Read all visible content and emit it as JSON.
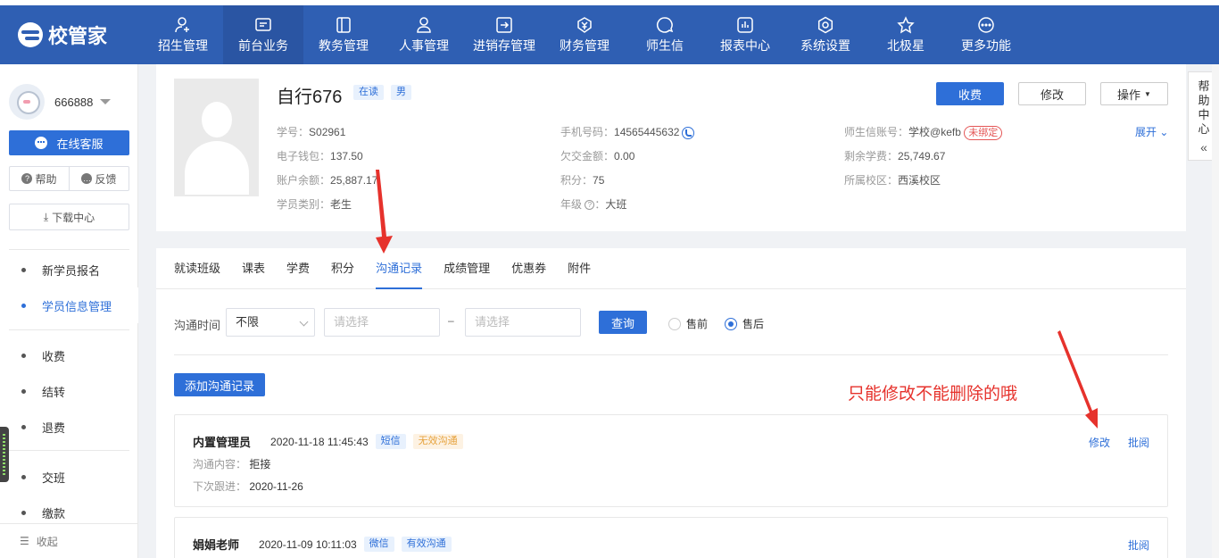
{
  "app": {
    "brand": "校管家"
  },
  "nav": {
    "items": [
      {
        "label": "招生管理",
        "icon": "person-add-icon"
      },
      {
        "label": "前台业务",
        "icon": "desk-icon"
      },
      {
        "label": "教务管理",
        "icon": "book-icon"
      },
      {
        "label": "人事管理",
        "icon": "person-icon"
      },
      {
        "label": "进销存管理",
        "icon": "box-in-icon"
      },
      {
        "label": "财务管理",
        "icon": "yen-shield-icon"
      },
      {
        "label": "师生信",
        "icon": "chat-icon"
      },
      {
        "label": "报表中心",
        "icon": "chart-icon"
      },
      {
        "label": "系统设置",
        "icon": "gear-icon"
      },
      {
        "label": "北极星",
        "icon": "star-icon"
      },
      {
        "label": "更多功能",
        "icon": "more-icon"
      }
    ],
    "active": "前台业务"
  },
  "sidebar": {
    "username": "666888",
    "online_service": "在线客服",
    "help": "帮助",
    "feedback": "反馈",
    "download": "下载中心",
    "group1": [
      "新学员报名",
      "学员信息管理"
    ],
    "group2": [
      "收费",
      "结转",
      "退费"
    ],
    "group3": [
      "交班",
      "缴款"
    ],
    "collapse": "收起"
  },
  "student": {
    "name": "自行676",
    "status_tag": "在读",
    "gender_tag": "男",
    "fields": {
      "id_label": "学号：",
      "id": "S02961",
      "wallet_label": "电子钱包：",
      "wallet": "137.50",
      "balance_label": "账户余额：",
      "balance": "25,887.17",
      "category_label": "学员类别：",
      "category": "老生",
      "phone_label": "手机号码：",
      "phone": "14565445632",
      "owed_label": "欠交金额：",
      "owed": "0.00",
      "points_label": "积分：",
      "points": "75",
      "grade_label": "年级",
      "grade_sep": "：",
      "grade": "大班",
      "account_label": "师生信账号：",
      "account": "学校@kefb",
      "unbound": "未绑定",
      "remaining_label": "剩余学费：",
      "remaining": "25,749.67",
      "campus_label": "所属校区：",
      "campus": "西溪校区"
    },
    "actions": {
      "charge": "收费",
      "edit": "修改",
      "operate": "操作",
      "expand": "展开"
    }
  },
  "tabs": [
    "就读班级",
    "课表",
    "学费",
    "积分",
    "沟通记录",
    "成绩管理",
    "优惠券",
    "附件"
  ],
  "active_tab": "沟通记录",
  "filter": {
    "label": "沟通时间",
    "range": "不限",
    "start_placeholder": "请选择",
    "sep": "–",
    "end_placeholder": "请选择",
    "query": "查询",
    "presale": "售前",
    "aftersale": "售后",
    "selected": "售后"
  },
  "add_button": "添加沟通记录",
  "records": [
    {
      "name": "内置管理员",
      "time": "2020-11-18 11:45:43",
      "channel": "短信",
      "effect": "无效沟通",
      "content_label": "沟通内容：",
      "content": "拒接",
      "next_label": "下次跟进：",
      "next": "2020-11-26",
      "edit": "修改",
      "review": "批阅"
    },
    {
      "name": "娟娟老师",
      "time": "2020-11-09 10:11:03",
      "channel": "微信",
      "effect": "有效沟通",
      "review": "批阅"
    }
  ],
  "annotation": "只能修改不能删除的哦",
  "help_panel": {
    "text": [
      "帮",
      "助",
      "中",
      "心"
    ],
    "arrow": "«"
  },
  "colors": {
    "primary": "#2e6fd8",
    "topbar": "#2f5fb3",
    "annotation": "#e6322c"
  }
}
